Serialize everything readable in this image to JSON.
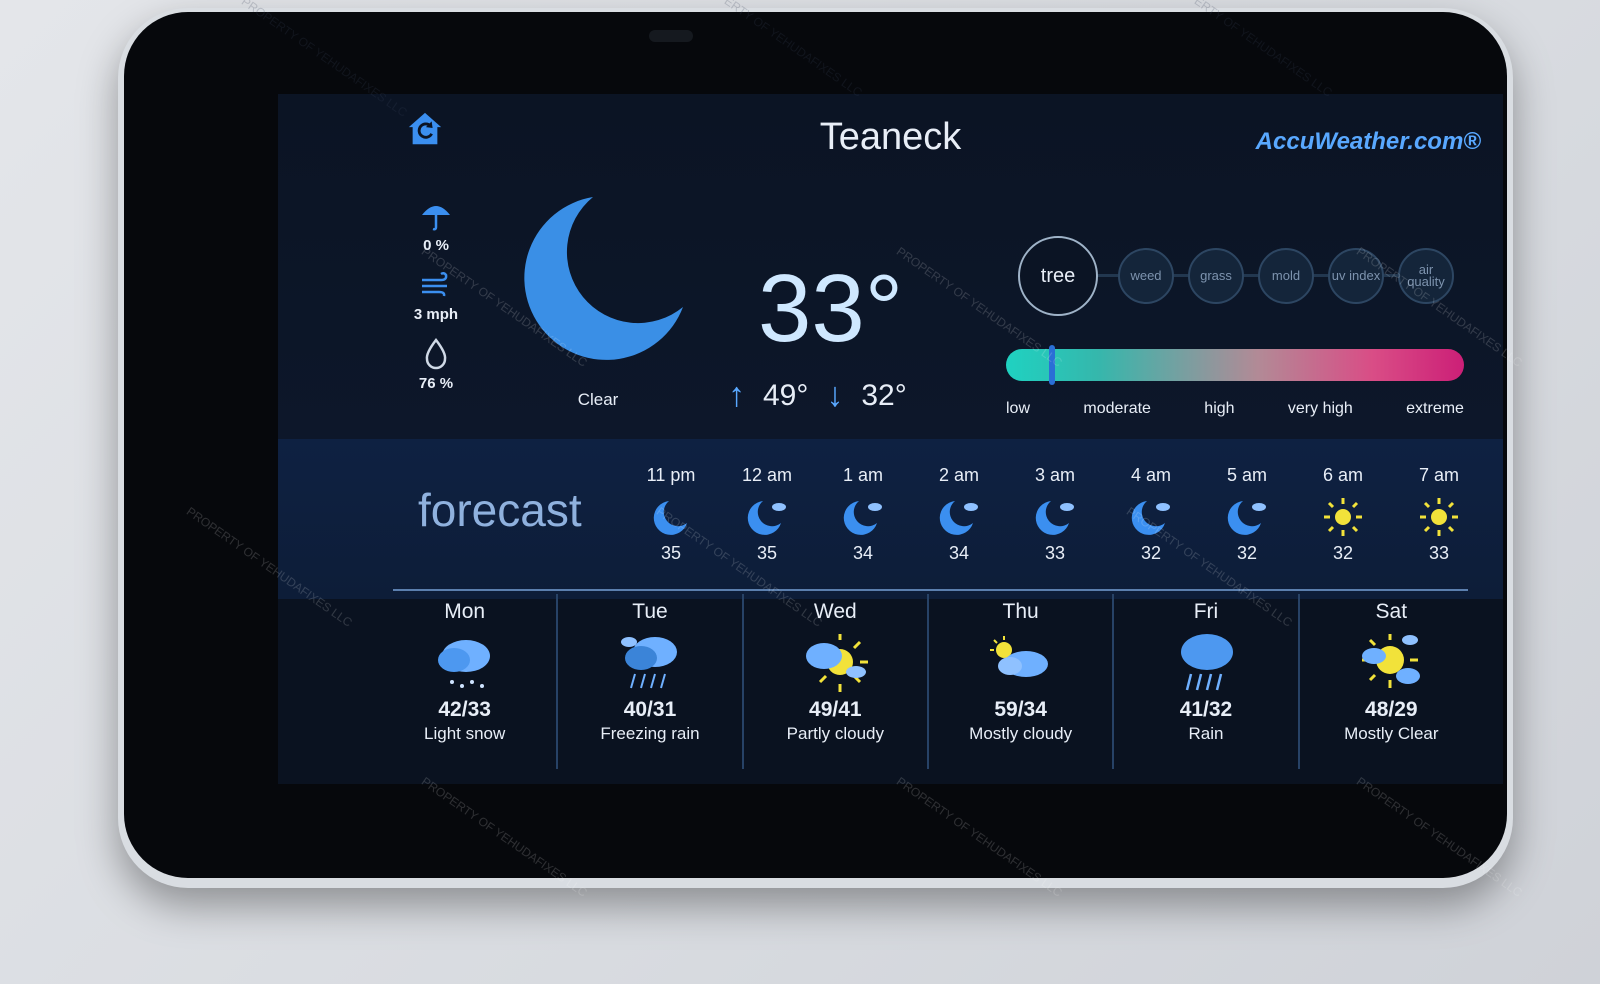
{
  "header": {
    "city": "Teaneck",
    "brand": "AccuWeather.com®"
  },
  "icons": {
    "home": "home-icon",
    "precip": "umbrella-icon",
    "wind": "wind-icon",
    "humidity": "droplet-icon",
    "current": "moon-icon"
  },
  "current": {
    "precip": "0 %",
    "wind": "3 mph",
    "humidity": "76 %",
    "condition": "Clear",
    "temp": "33°",
    "high": "49°",
    "low": "32°"
  },
  "pollen": {
    "tabs": [
      {
        "label": "tree",
        "active": true
      },
      {
        "label": "weed",
        "active": false
      },
      {
        "label": "grass",
        "active": false
      },
      {
        "label": "mold",
        "active": false
      },
      {
        "label": "uv index",
        "active": false
      },
      {
        "label": "air quality",
        "active": false
      }
    ],
    "scale_labels": [
      "low",
      "moderate",
      "high",
      "very high",
      "extreme"
    ],
    "level_fraction": 0.1
  },
  "forecast": {
    "title": "forecast",
    "hours": [
      {
        "time": "11 pm",
        "temp": "35",
        "icon": "moon-icon"
      },
      {
        "time": "12 am",
        "temp": "35",
        "icon": "moon-cloud-icon"
      },
      {
        "time": "1 am",
        "temp": "34",
        "icon": "moon-cloud-icon"
      },
      {
        "time": "2 am",
        "temp": "34",
        "icon": "moon-cloud-icon"
      },
      {
        "time": "3 am",
        "temp": "33",
        "icon": "moon-cloud-icon"
      },
      {
        "time": "4 am",
        "temp": "32",
        "icon": "moon-cloud-icon"
      },
      {
        "time": "5 am",
        "temp": "32",
        "icon": "moon-cloud-icon"
      },
      {
        "time": "6 am",
        "temp": "32",
        "icon": "sun-icon"
      },
      {
        "time": "7 am",
        "temp": "33",
        "icon": "sun-icon"
      }
    ],
    "days": [
      {
        "name": "Mon",
        "temps": "42/33",
        "condition": "Light snow",
        "icon": "snow-cloud-icon"
      },
      {
        "name": "Tue",
        "temps": "40/31",
        "condition": "Freezing rain",
        "icon": "freezing-rain-icon"
      },
      {
        "name": "Wed",
        "temps": "49/41",
        "condition": "Partly cloudy",
        "icon": "partly-cloudy-icon"
      },
      {
        "name": "Thu",
        "temps": "59/34",
        "condition": "Mostly cloudy",
        "icon": "mostly-cloudy-icon"
      },
      {
        "name": "Fri",
        "temps": "41/32",
        "condition": "Rain",
        "icon": "rain-cloud-icon"
      },
      {
        "name": "Sat",
        "temps": "48/29",
        "condition": "Mostly Clear",
        "icon": "mostly-clear-icon"
      }
    ]
  },
  "watermark": "PROPERTY OF YEHUDAFIXES LLC",
  "colors": {
    "accent": "#59a8ff",
    "screen_bg": "#0a1220",
    "band_bg": "#0e2142"
  }
}
